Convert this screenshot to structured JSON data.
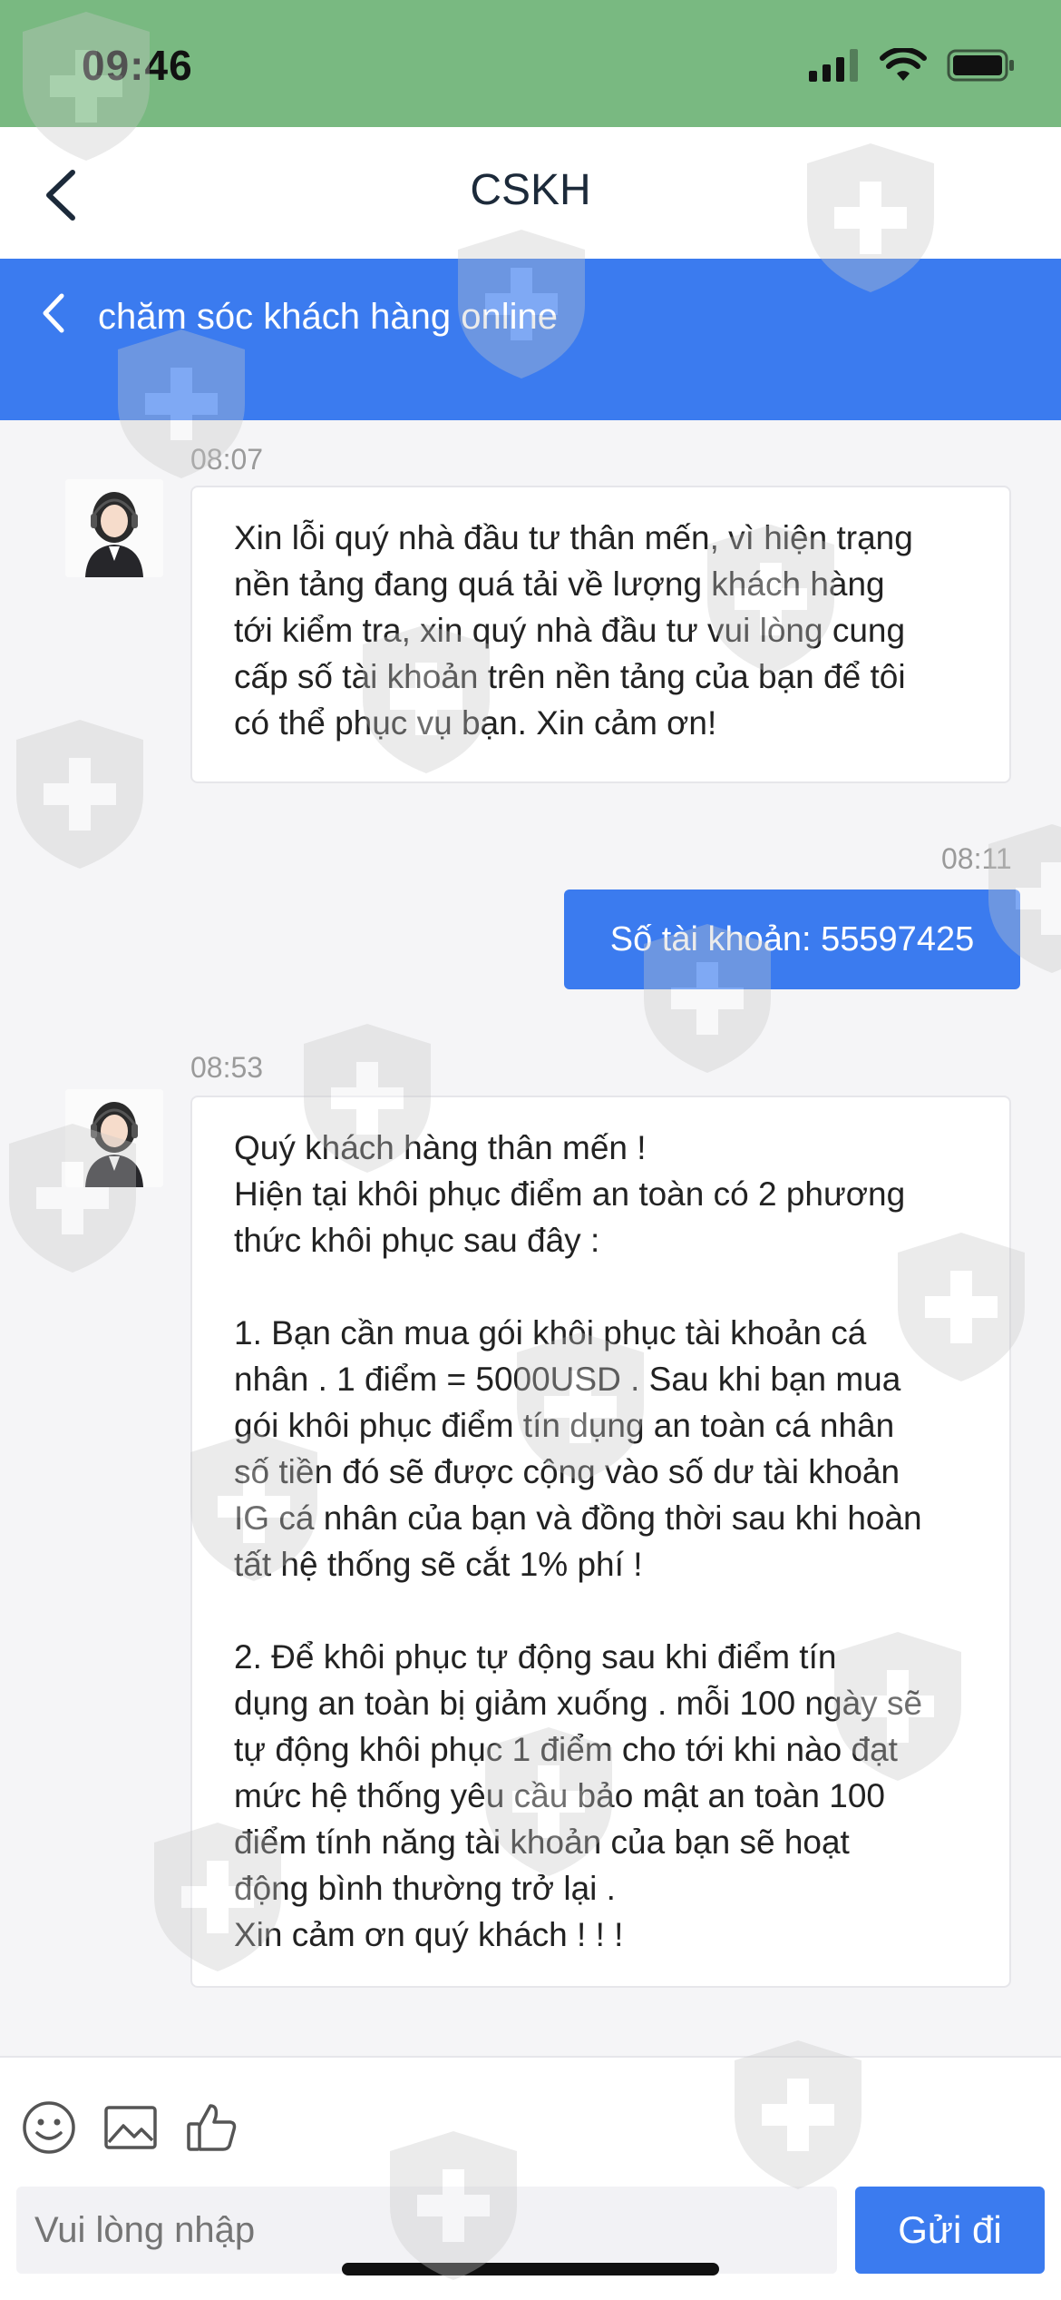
{
  "status_bar": {
    "time": "09:46"
  },
  "nav": {
    "title": "CSKH"
  },
  "banner": {
    "title": "chăm sóc khách hàng online"
  },
  "messages": [
    {
      "time": "08:07",
      "text": "Xin lỗi quý nhà đầu tư thân mến, vì hiện trạng\nnền tảng đang quá tải về lượng khách hàng\ntới kiểm tra, xin quý nhà đầu tư vui lòng cung\ncấp số tài khoản trên nền tảng của bạn để tôi\ncó thể phục vụ bạn. Xin cảm ơn!"
    },
    {
      "time": "08:11",
      "text": "Số tài khoản: 55597425"
    },
    {
      "time": "08:53",
      "text": "Quý khách hàng thân mến !\nHiện tại khôi phục điểm an toàn có 2 phương\nthức khôi phục sau đây :\n\n1. Bạn cần mua gói khôi phục tài khoản cá\nnhân . 1 điểm = 5000USD . Sau khi bạn mua\ngói khôi phục điểm tín dụng an toàn cá nhân\nsố tiền đó sẽ được cộng vào số dư tài khoản\nIG cá nhân của bạn và đồng thời sau khi hoàn\ntất hệ thống sẽ cắt 1% phí !\n\n2. Để khôi phục tự động sau khi điểm tín\ndụng an toàn bị giảm xuống . mỗi 100 ngày sẽ\ntự động khôi phục 1 điểm cho tới khi nào đạt\nmức hệ thống yêu cầu bảo mật an toàn 100\nđiểm tính năng tài khoản của bạn sẽ hoạt\nđộng bình thường trở lại .\nXin cảm ơn quý khách ! ! !"
    }
  ],
  "composer": {
    "placeholder": "Vui lòng nhập",
    "send_label": "Gửi đi"
  },
  "colors": {
    "status_bar": "#79b981",
    "accent": "#3b7bef"
  },
  "icons": [
    "back-icon",
    "emoji-icon",
    "image-icon",
    "thumbs-up-icon",
    "signal-icon",
    "wifi-icon",
    "battery-icon"
  ]
}
